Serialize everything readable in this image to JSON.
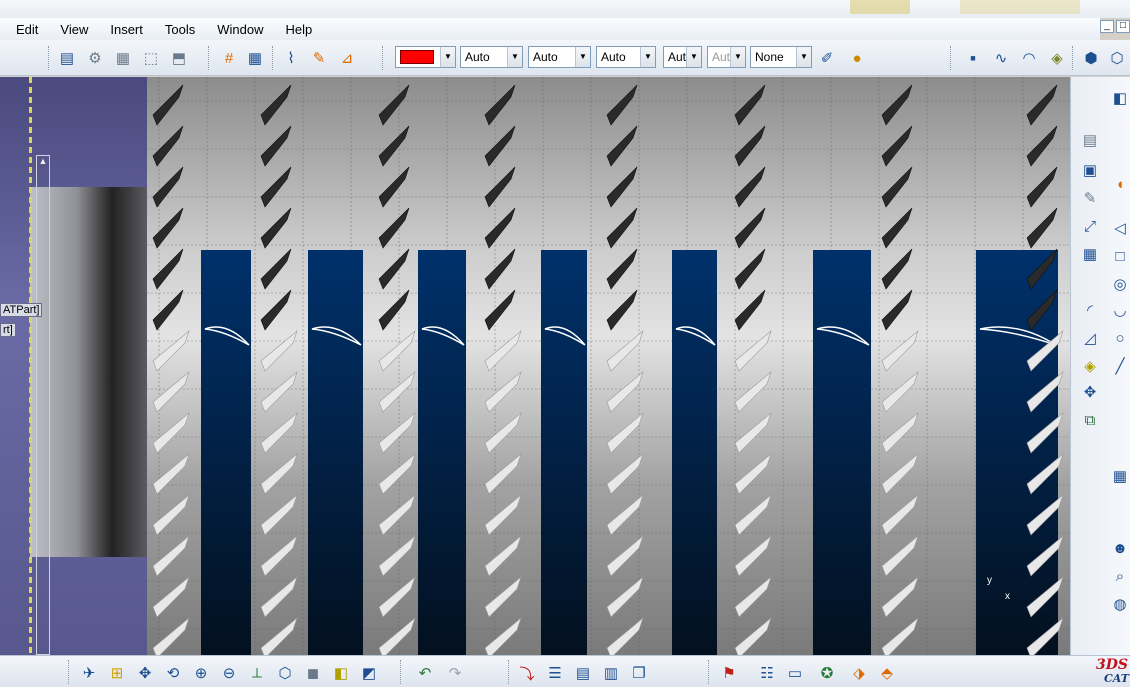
{
  "menu": [
    "Edit",
    "View",
    "Insert",
    "Tools",
    "Window",
    "Help"
  ],
  "toolbar": {
    "color_combo": "",
    "line_combo_1": "Auto",
    "line_combo_2": "Auto",
    "line_combo_3": "Auto",
    "line_combo_4": "Aut",
    "line_combo_5": "Aut",
    "layer_combo": "None",
    "accent_color": "#ff0000"
  },
  "tree": {
    "label_1": "ATPart]",
    "label_2": "rt]"
  },
  "viewport": {
    "axis_y": "y",
    "axis_x": "x",
    "panel_color": "#00316b"
  },
  "window_controls": {
    "minimize": "_",
    "restore": "□"
  },
  "brand": {
    "logo_main": "3DS",
    "logo_sub": "CAT"
  }
}
